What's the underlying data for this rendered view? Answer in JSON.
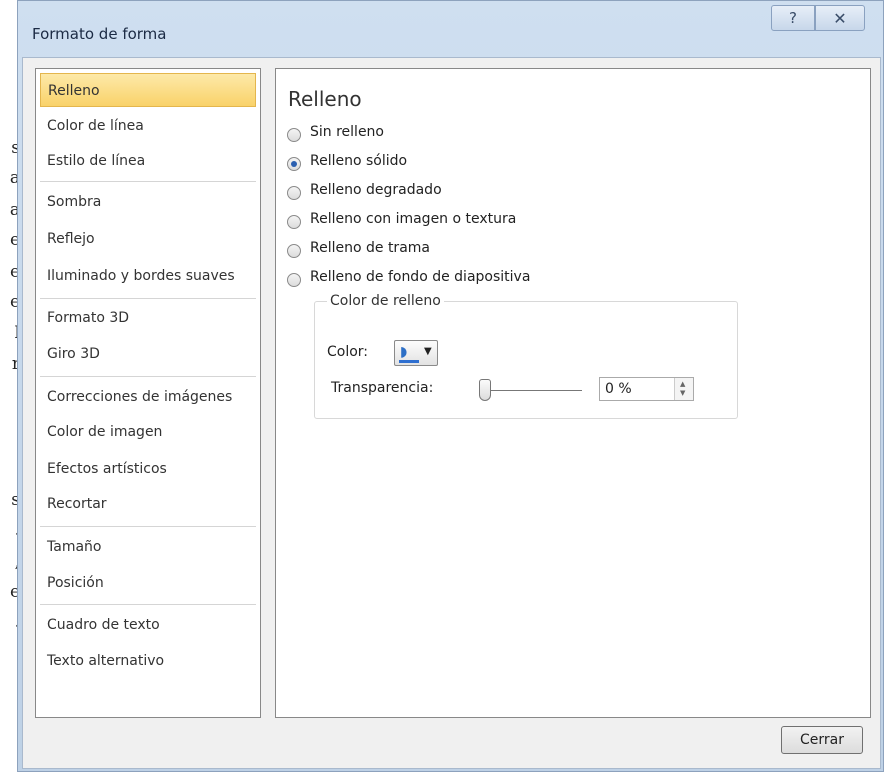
{
  "background_text": [
    "s",
    "a",
    "a",
    "e",
    "e",
    "e",
    "l",
    "r",
    "s",
    ".",
    ",",
    "e",
    "."
  ],
  "dialog": {
    "title": "Formato de forma",
    "help_icon": "question-mark-icon",
    "close_icon": "close-x-icon"
  },
  "sidebar": {
    "items": [
      {
        "label": "Relleno",
        "selected": true
      },
      {
        "label": "Color de línea"
      },
      {
        "label": "Estilo de línea"
      },
      {
        "label": "Sombra"
      },
      {
        "label": "Reflejo"
      },
      {
        "label": "Iluminado y bordes suaves"
      },
      {
        "label": "Formato 3D"
      },
      {
        "label": "Giro 3D"
      },
      {
        "label": "Correcciones de imágenes"
      },
      {
        "label": "Color de imagen"
      },
      {
        "label": "Efectos artísticos"
      },
      {
        "label": "Recortar"
      },
      {
        "label": "Tamaño"
      },
      {
        "label": "Posición"
      },
      {
        "label": "Cuadro de texto"
      },
      {
        "label": "Texto alternativo"
      }
    ]
  },
  "content": {
    "heading": "Relleno",
    "options": [
      {
        "label": "Sin relleno",
        "checked": false
      },
      {
        "label": "Relleno sólido",
        "checked": true
      },
      {
        "label": "Relleno degradado",
        "checked": false
      },
      {
        "label": "Relleno con imagen o textura",
        "checked": false
      },
      {
        "label": "Relleno de trama",
        "checked": false
      },
      {
        "label": "Relleno de fondo de diapositiva",
        "checked": false
      }
    ],
    "fill_group": {
      "legend": "Color de relleno",
      "color_label": "Color:",
      "color_icon": "paint-bucket-icon",
      "color_value": "#2e6fd0",
      "transparency_label": "Transparencia:",
      "transparency_value": "0 %",
      "transparency_fraction": 0
    }
  },
  "footer": {
    "close_label": "Cerrar"
  },
  "colors": {
    "selection": "#f9d26a",
    "frame": "#c4d6ea",
    "radio_dot": "#2a5fb0"
  }
}
